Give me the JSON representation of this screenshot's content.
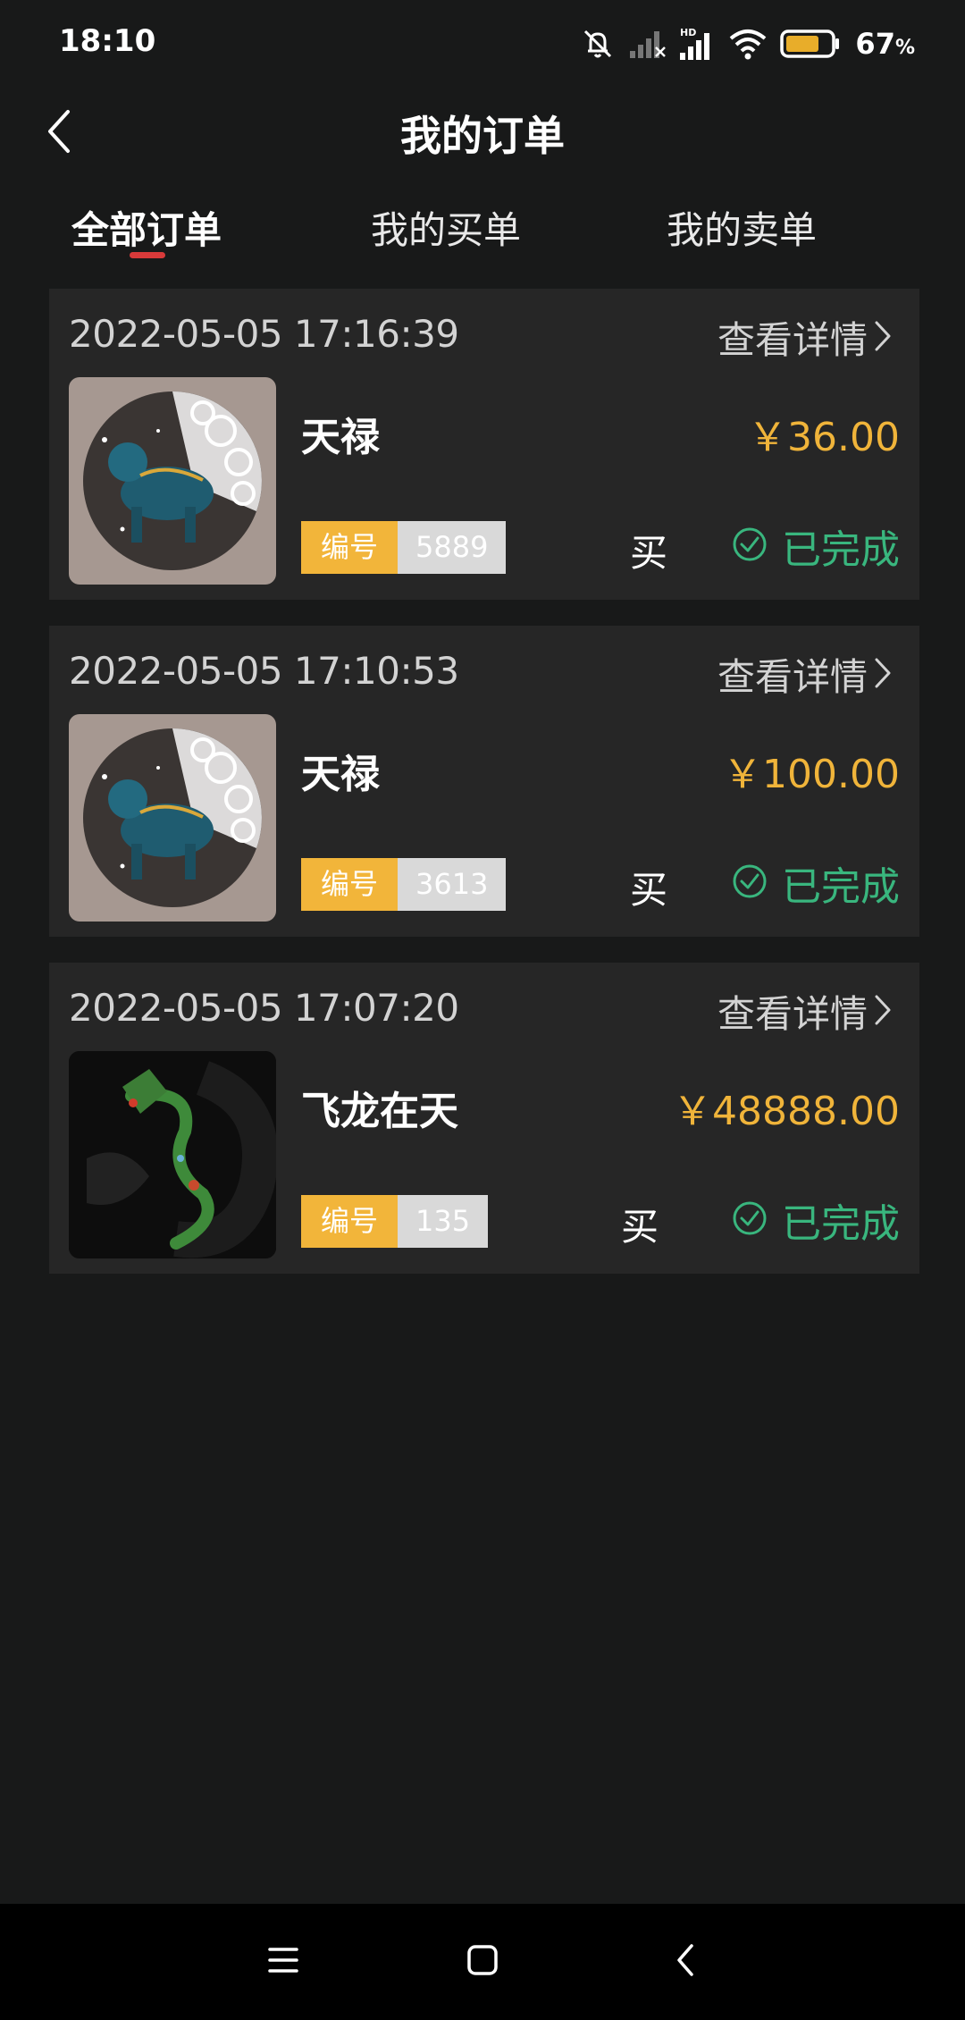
{
  "status_bar": {
    "time": "18:10",
    "battery_percent": "67",
    "battery_unit": "%",
    "hd_label": "HD",
    "icons": [
      "bell-muted-icon",
      "signal-1-icon",
      "signal-2-icon",
      "wifi-icon",
      "battery-icon"
    ]
  },
  "header": {
    "title": "我的订单",
    "back_icon": "chevron-left-icon"
  },
  "tabs": [
    {
      "label": "全部订单",
      "active": true
    },
    {
      "label": "我的买单",
      "active": false
    },
    {
      "label": "我的卖单",
      "active": false
    }
  ],
  "orders": [
    {
      "time": "2022-05-05 17:16:39",
      "detail_label": "查看详情",
      "name": "天禄",
      "price": "￥36.00",
      "serial_label": "编号",
      "serial_number": "5889",
      "type": "买",
      "status": "已完成"
    },
    {
      "time": "2022-05-05 17:10:53",
      "detail_label": "查看详情",
      "name": "天禄",
      "price": "￥100.00",
      "serial_label": "编号",
      "serial_number": "3613",
      "type": "买",
      "status": "已完成"
    },
    {
      "time": "2022-05-05 17:07:20",
      "detail_label": "查看详情",
      "name": "飞龙在天",
      "price": "￥48888.00",
      "serial_label": "编号",
      "serial_number": "135",
      "type": "买",
      "status": "已完成"
    }
  ],
  "colors": {
    "background": "#181919",
    "card": "#262626",
    "price": "#f0b43a",
    "serial_label_bg": "#f2b53a",
    "status_complete": "#39b67e",
    "tab_indicator": "#d83a3a"
  },
  "nav_bar": {
    "icons": [
      "menu-icon",
      "home-icon",
      "back-icon"
    ]
  }
}
